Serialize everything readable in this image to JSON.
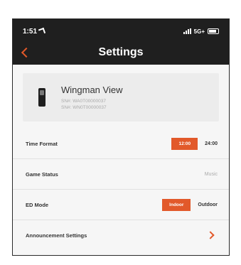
{
  "status": {
    "time": "1:51",
    "carrier": "5G+"
  },
  "header": {
    "title": "Settings"
  },
  "device": {
    "name": "Wingman View",
    "sn1": "SN#: WA0T00000037",
    "sn2": "SN#: WN0T00000037"
  },
  "settings": {
    "time_format": {
      "label": "Time Format",
      "selected": "12:00",
      "other": "24:00"
    },
    "game_status": {
      "label": "Game Status",
      "value": "Music"
    },
    "ed_mode": {
      "label": "ED Mode",
      "selected": "Indoor",
      "other": "Outdoor"
    },
    "announcement": {
      "label": "Announcement Settings"
    }
  },
  "colors": {
    "accent": "#e2592a",
    "header_bg": "#1f1f1f"
  }
}
